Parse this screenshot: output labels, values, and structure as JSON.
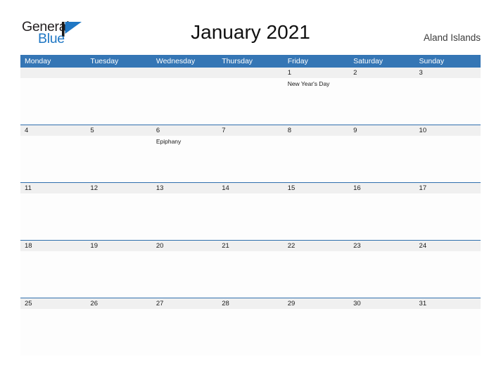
{
  "brand": {
    "name_part1": "General",
    "name_part2": "Blue",
    "flag_icon": "blue-flag-triangle",
    "accent_color": "#1f77c4",
    "text_color": "#231f20"
  },
  "header": {
    "title": "January 2021",
    "region": "Aland Islands"
  },
  "calendar": {
    "header_bg": "#3576b5",
    "date_band_bg": "#f0f0f0",
    "week_rule_color": "#2f6fad",
    "day_names": [
      "Monday",
      "Tuesday",
      "Wednesday",
      "Thursday",
      "Friday",
      "Saturday",
      "Sunday"
    ],
    "weeks": [
      {
        "has_top_rule": false,
        "days": [
          {
            "date": "",
            "event": ""
          },
          {
            "date": "",
            "event": ""
          },
          {
            "date": "",
            "event": ""
          },
          {
            "date": "",
            "event": ""
          },
          {
            "date": "1",
            "event": "New Year's Day"
          },
          {
            "date": "2",
            "event": ""
          },
          {
            "date": "3",
            "event": ""
          }
        ]
      },
      {
        "has_top_rule": true,
        "days": [
          {
            "date": "4",
            "event": ""
          },
          {
            "date": "5",
            "event": ""
          },
          {
            "date": "6",
            "event": "Epiphany"
          },
          {
            "date": "7",
            "event": ""
          },
          {
            "date": "8",
            "event": ""
          },
          {
            "date": "9",
            "event": ""
          },
          {
            "date": "10",
            "event": ""
          }
        ]
      },
      {
        "has_top_rule": true,
        "days": [
          {
            "date": "11",
            "event": ""
          },
          {
            "date": "12",
            "event": ""
          },
          {
            "date": "13",
            "event": ""
          },
          {
            "date": "14",
            "event": ""
          },
          {
            "date": "15",
            "event": ""
          },
          {
            "date": "16",
            "event": ""
          },
          {
            "date": "17",
            "event": ""
          }
        ]
      },
      {
        "has_top_rule": true,
        "days": [
          {
            "date": "18",
            "event": ""
          },
          {
            "date": "19",
            "event": ""
          },
          {
            "date": "20",
            "event": ""
          },
          {
            "date": "21",
            "event": ""
          },
          {
            "date": "22",
            "event": ""
          },
          {
            "date": "23",
            "event": ""
          },
          {
            "date": "24",
            "event": ""
          }
        ]
      },
      {
        "has_top_rule": true,
        "days": [
          {
            "date": "25",
            "event": ""
          },
          {
            "date": "26",
            "event": ""
          },
          {
            "date": "27",
            "event": ""
          },
          {
            "date": "28",
            "event": ""
          },
          {
            "date": "29",
            "event": ""
          },
          {
            "date": "30",
            "event": ""
          },
          {
            "date": "31",
            "event": ""
          }
        ]
      }
    ]
  }
}
